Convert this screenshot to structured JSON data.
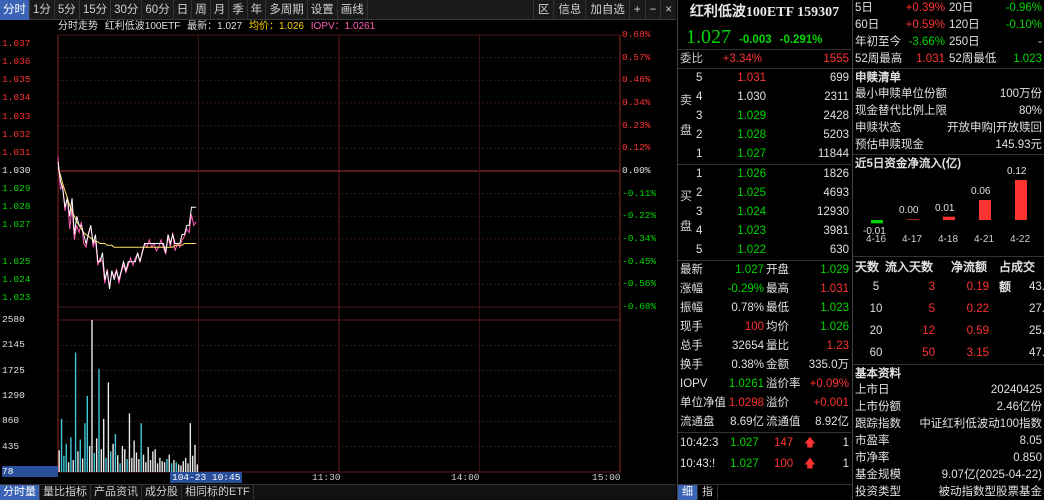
{
  "toolbar": {
    "left": [
      "分时",
      "1分",
      "5分",
      "15分",
      "30分",
      "60分",
      "日",
      "周",
      "月",
      "季",
      "年",
      "多周期",
      "设置",
      "画线"
    ],
    "right": [
      "区",
      "信息",
      "加自选",
      "+",
      "−",
      "×"
    ]
  },
  "header": {
    "prefix": "分时走势",
    "name": "红利低波100ETF",
    "latest_label": "最新：1.027",
    "avg_label": "均价：1.026",
    "iopv_label": "IOPV：1.0261"
  },
  "price_axis": {
    "left": [
      "1.037",
      "1.036",
      "1.035",
      "1.034",
      "1.033",
      "1.032",
      "1.031",
      "1.030",
      "1.029",
      "1.028",
      "1.027",
      "1.025",
      "1.024",
      "1.023"
    ],
    "right": [
      "0.68%",
      "0.57%",
      "0.46%",
      "0.34%",
      "0.23%",
      "0.12%",
      "0.00%",
      "-0.11%",
      "-0.22%",
      "-0.34%",
      "-0.45%",
      "-0.56%",
      "-0.68%"
    ]
  },
  "volume_axis": [
    "2580",
    "2145",
    "1725",
    "1290",
    "860",
    "435",
    "78"
  ],
  "time_axis": {
    "start_badge": "104-23 10:45",
    "ticks": [
      "11:30",
      "14:00",
      "15:00"
    ]
  },
  "bottom_tabs": [
    "分时量",
    "量比指标",
    "产品资讯",
    "成分股",
    "相同标的ETF"
  ],
  "colors": {
    "up": "#ff3232",
    "down": "#00d600",
    "price_line": "#ffffff",
    "avg_line": "#ffe066",
    "iopv_line": "#ff5ab4",
    "accent": "#3b63b5"
  },
  "chart_data": {
    "type": "line",
    "x_label": "time",
    "ylim": [
      1.0225,
      1.0375
    ],
    "prev_close": 1.03,
    "series": [
      {
        "values": [
          1.0305,
          1.0295,
          1.029,
          1.028,
          1.0285,
          1.0275,
          1.0285,
          1.0265,
          1.0275,
          1.027,
          1.027,
          1.0265,
          1.026,
          1.0265,
          1.027,
          1.026,
          1.0265,
          1.025,
          1.025,
          1.0255,
          1.024,
          1.0245,
          1.0235,
          1.0245,
          1.024,
          1.0245,
          1.024,
          1.0245,
          1.025,
          1.0245,
          1.025,
          1.025,
          1.025,
          1.025,
          1.0255,
          1.025,
          1.0255,
          1.026,
          1.026,
          1.026,
          1.026,
          1.026,
          1.026,
          1.026,
          1.026,
          1.026,
          1.0255,
          1.0265,
          1.026,
          1.0265,
          1.026,
          1.026,
          1.026,
          1.0265,
          1.0265,
          1.027,
          1.027,
          1.028,
          1.028,
          1.028
        ]
      },
      {
        "values": [
          1.0302,
          1.0298,
          1.0293,
          1.0289,
          1.0285,
          1.0281,
          1.0278,
          1.0275,
          1.0272,
          1.027,
          1.0268,
          1.0266,
          1.0265,
          1.0264,
          1.0263,
          1.0262,
          1.0261,
          1.0261,
          1.026,
          1.026,
          1.026,
          1.0259,
          1.0259,
          1.0259,
          1.0258,
          1.0258,
          1.0258,
          1.0258,
          1.0258,
          1.0258,
          1.0258,
          1.0258,
          1.0258,
          1.0258,
          1.0258,
          1.0258,
          1.0258,
          1.0258,
          1.0258,
          1.0258,
          1.0258,
          1.0258,
          1.0258,
          1.0258,
          1.0258,
          1.0258,
          1.0258,
          1.0258,
          1.0258,
          1.0258,
          1.0259,
          1.0259,
          1.0259,
          1.0259,
          1.026,
          1.026,
          1.026,
          1.026,
          1.026,
          1.026
        ]
      },
      {
        "values": [
          1.0308,
          1.029,
          1.0292,
          1.0278,
          1.0286,
          1.0268,
          1.028,
          1.0262,
          1.027,
          1.0266,
          1.0272,
          1.026,
          1.0258,
          1.0266,
          1.027,
          1.0258,
          1.0262,
          1.0248,
          1.0252,
          1.025,
          1.0238,
          1.0246,
          1.0236,
          1.0244,
          1.0242,
          1.0246,
          1.0238,
          1.0244,
          1.0248,
          1.0244,
          1.0248,
          1.0252,
          1.0248,
          1.0252,
          1.0254,
          1.025,
          1.0256,
          1.026,
          1.0258,
          1.0262,
          1.0258,
          1.026,
          1.0256,
          1.0258,
          1.0262,
          1.0258,
          1.0254,
          1.0264,
          1.0258,
          1.0266,
          1.0256,
          1.026,
          1.0258,
          1.0262,
          1.0264,
          1.0268,
          1.0266,
          1.0276,
          1.027,
          1.0272
        ]
      }
    ],
    "volume": [
      400,
      980,
      300,
      520,
      180,
      640,
      220,
      2200,
      380,
      600,
      250,
      900,
      1400,
      480,
      2800,
      350,
      620,
      1900,
      420,
      980,
      260,
      1650,
      380,
      520,
      700,
      310,
      160,
      480,
      420,
      240,
      1080,
      260,
      580,
      360,
      240,
      900,
      320,
      180,
      460,
      220,
      380,
      420,
      160,
      260,
      200,
      180,
      240,
      320,
      160,
      220,
      180,
      140,
      120,
      200,
      260,
      160,
      900,
      300,
      500,
      140
    ],
    "volume_ylim": [
      0,
      2800
    ]
  },
  "quote": {
    "title": "红利低波100ETF 159307",
    "price": "1.027",
    "change": "-0.003",
    "change_pct": "-0.291%",
    "weibi_label": "委比",
    "weibi_value": "+3.34%",
    "weibi_diff": "1555",
    "sell_label": [
      "卖",
      "盘"
    ],
    "buy_label": [
      "买",
      "盘"
    ],
    "asks": [
      {
        "level": "5",
        "price": "1.031",
        "vol": "699",
        "color": "red"
      },
      {
        "level": "4",
        "price": "1.030",
        "vol": "2311",
        "color": "white"
      },
      {
        "level": "3",
        "price": "1.029",
        "vol": "2428",
        "color": "green"
      },
      {
        "level": "2",
        "price": "1.028",
        "vol": "5203",
        "color": "green"
      },
      {
        "level": "1",
        "price": "1.027",
        "vol": "11844",
        "color": "green"
      }
    ],
    "bids": [
      {
        "level": "1",
        "price": "1.026",
        "vol": "1826",
        "color": "green"
      },
      {
        "level": "2",
        "price": "1.025",
        "vol": "4693",
        "color": "green"
      },
      {
        "level": "3",
        "price": "1.024",
        "vol": "12930",
        "color": "green"
      },
      {
        "level": "4",
        "price": "1.023",
        "vol": "3981",
        "color": "green"
      },
      {
        "level": "5",
        "price": "1.022",
        "vol": "630",
        "color": "green"
      }
    ],
    "stats": [
      {
        "k1": "最新",
        "v1": "1.027",
        "c1": "green",
        "k2": "开盘",
        "v2": "1.029",
        "c2": "green"
      },
      {
        "k1": "涨幅",
        "v1": "-0.29%",
        "c1": "green",
        "k2": "最高",
        "v2": "1.031",
        "c2": "red"
      },
      {
        "k1": "振幅",
        "v1": "0.78%",
        "c1": "white",
        "k2": "最低",
        "v2": "1.023",
        "c2": "green"
      },
      {
        "k1": "现手",
        "v1": "100",
        "c1": "red",
        "k2": "均价",
        "v2": "1.026",
        "c2": "green"
      },
      {
        "k1": "总手",
        "v1": "32654",
        "c1": "white",
        "k2": "量比",
        "v2": "1.23",
        "c2": "red"
      },
      {
        "k1": "换手",
        "v1": "0.38%",
        "c1": "white",
        "k2": "金额",
        "v2": "335.0万",
        "c2": "white"
      },
      {
        "k1": "IOPV",
        "v1": "1.0261",
        "c1": "green",
        "k2": "溢价率",
        "v2": "+0.09%",
        "c2": "red"
      },
      {
        "k1": "单位净值",
        "v1": "1.0298",
        "c1": "red",
        "k2": "溢价",
        "v2": "+0.001",
        "c2": "red"
      },
      {
        "k1": "流通盘",
        "v1": "8.69亿",
        "c1": "white",
        "k2": "流通值",
        "v2": "8.92亿",
        "c2": "white"
      }
    ],
    "ticks": [
      {
        "time": "10:42:3",
        "price": "1.027",
        "vol": "147",
        "arrow": "🡅",
        "n": "1"
      },
      {
        "time": "10:43:!",
        "price": "1.027",
        "vol": "100",
        "arrow": "🡅",
        "n": "1"
      }
    ],
    "tabs": [
      "细",
      "指"
    ]
  },
  "right": {
    "returns": [
      {
        "a": "5日",
        "b": "+0.39%",
        "bc": "red",
        "c": "20日",
        "d": "-0.96%",
        "dc": "green"
      },
      {
        "a": "60日",
        "b": "+0.59%",
        "bc": "red",
        "c": "120日",
        "d": "-0.10%",
        "dc": "green"
      },
      {
        "a": "年初至今",
        "b": "-3.66%",
        "bc": "green",
        "c": "250日",
        "d": "-",
        "dc": "white"
      },
      {
        "a": "52周最高",
        "b": "1.031",
        "bc": "red",
        "c": "52周最低",
        "d": "1.023",
        "dc": "green"
      }
    ],
    "subscription_title": "申赎清单",
    "subscription": [
      {
        "k": "最小申赎单位份额",
        "v": "100万份"
      },
      {
        "k": "现金替代比例上限",
        "v": "80%"
      },
      {
        "k": "申赎状态",
        "v": "开放申购|开放赎回"
      },
      {
        "k": "预估申赎现金",
        "v": "145.93元"
      }
    ],
    "flow_title": "近5日资金净流入(亿)",
    "flow_chart": {
      "dates": [
        "4-16",
        "4-17",
        "4-18",
        "4-21",
        "4-22"
      ],
      "values": [
        "-0.01",
        "0.00",
        "0.01",
        "0.06",
        "0.12"
      ]
    },
    "flow_header": [
      "天数",
      "流入天数",
      "净流额",
      "占成交额"
    ],
    "flow_rows": [
      {
        "days": "5",
        "in_days": "3",
        "net": "0.19",
        "pct": "43."
      },
      {
        "days": "10",
        "in_days": "5",
        "net": "0.22",
        "pct": "27."
      },
      {
        "days": "20",
        "in_days": "12",
        "net": "0.59",
        "pct": "25."
      },
      {
        "days": "60",
        "in_days": "50",
        "net": "3.15",
        "pct": "47."
      }
    ],
    "basic_title": "基本资料",
    "basic": [
      {
        "k": "上市日",
        "v": "20240425"
      },
      {
        "k": "上市份额",
        "v": "2.46亿份"
      },
      {
        "k": "跟踪指数",
        "v": "中证红利低波动100指数"
      },
      {
        "k": "市盈率",
        "v": "8.05"
      },
      {
        "k": "市净率",
        "v": "0.850"
      },
      {
        "k": "基金规模",
        "v": "9.07亿(2025-04-22)"
      },
      {
        "k": "投资类型",
        "v": "被动指数型股票基金"
      }
    ]
  }
}
